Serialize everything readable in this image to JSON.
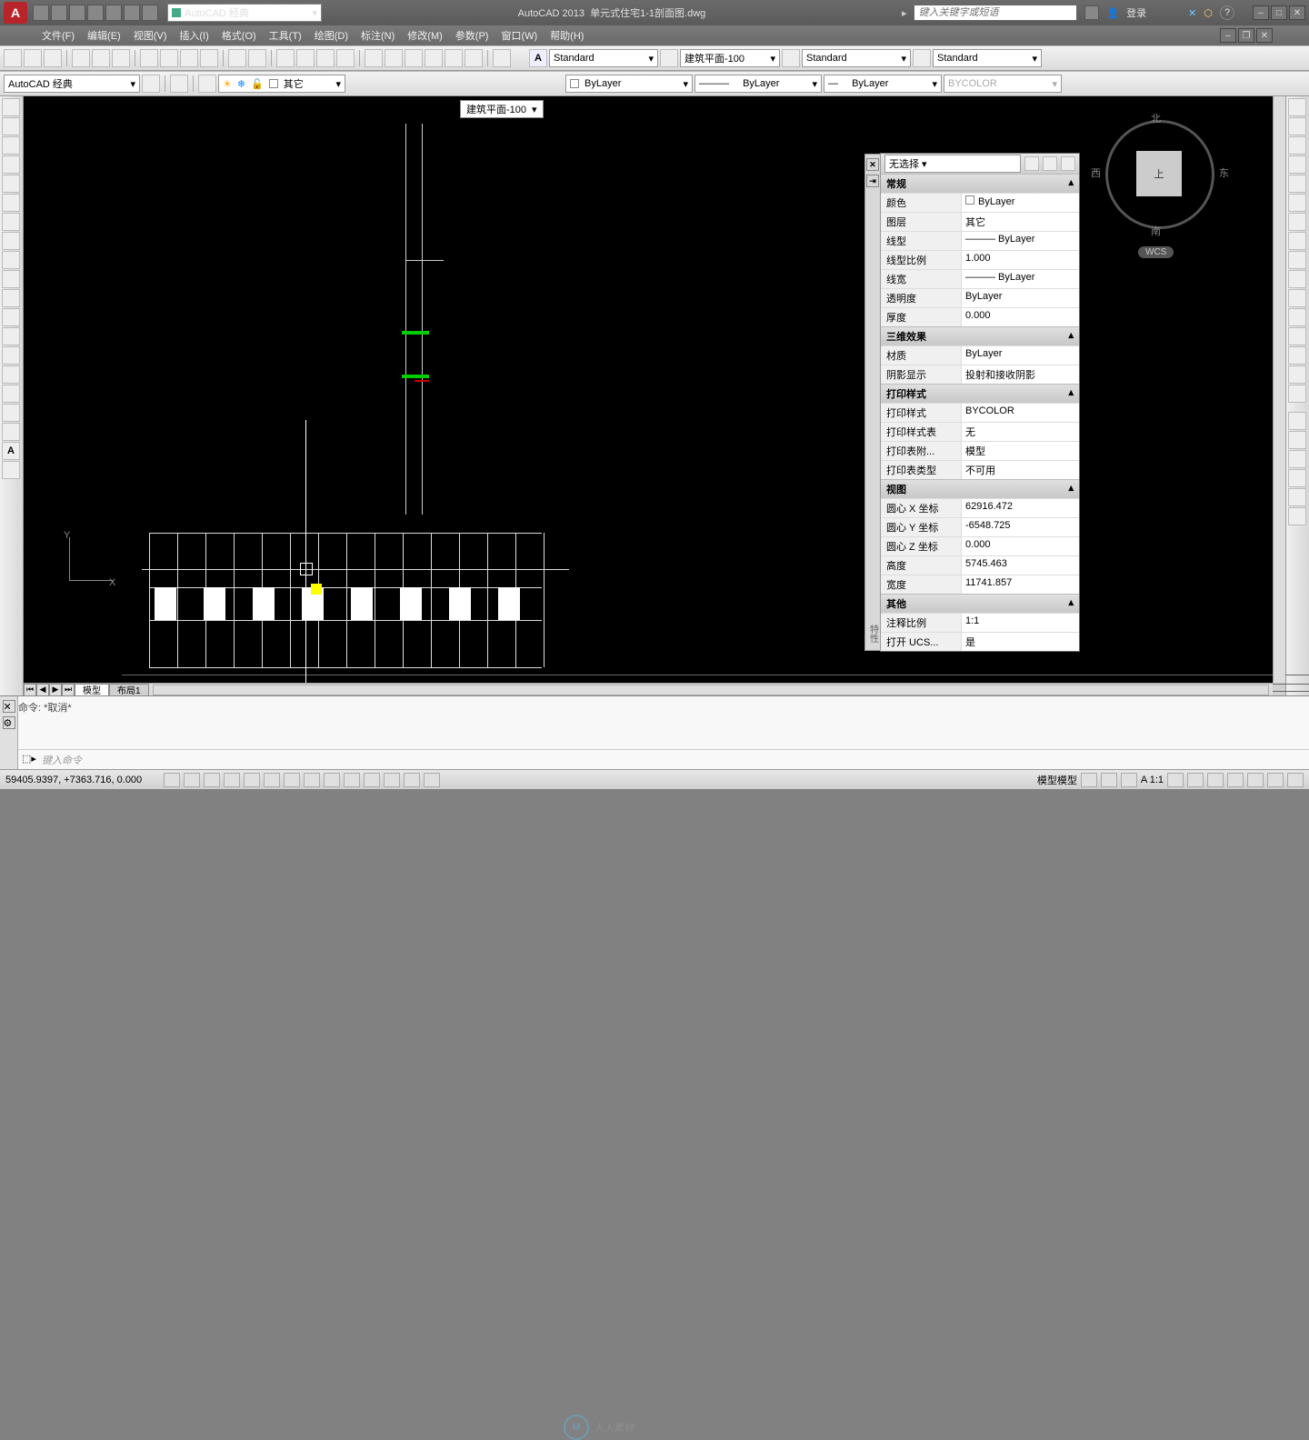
{
  "title": {
    "app": "AutoCAD 2013",
    "file": "单元式住宅1-1剖面图.dwg",
    "search_ph": "键入关键字或短语",
    "login": "登录",
    "workspace": "AutoCAD 经典"
  },
  "menus": [
    "文件(F)",
    "编辑(E)",
    "视图(V)",
    "插入(I)",
    "格式(O)",
    "工具(T)",
    "绘图(D)",
    "标注(N)",
    "修改(M)",
    "参数(P)",
    "窗口(W)",
    "帮助(H)"
  ],
  "tb_styles": {
    "text": "Standard",
    "dim": "建筑平面-100",
    "table": "Standard",
    "mleader": "Standard"
  },
  "tb_layers": {
    "ws": "AutoCAD 经典",
    "layer": "其它",
    "color": "ByLayer",
    "ltype": "ByLayer",
    "lweight": "ByLayer",
    "plotstyle": "BYCOLOR"
  },
  "view_dd": "建筑平面-100",
  "viewcube": {
    "n": "北",
    "s": "南",
    "e": "东",
    "w": "西",
    "top": "上",
    "wcs": "WCS"
  },
  "props": {
    "selector": "无选择",
    "cats": {
      "general": "常规",
      "threed": "三维效果",
      "plot": "打印样式",
      "view": "视图",
      "misc": "其他"
    },
    "general": [
      [
        "颜色",
        "ByLayer"
      ],
      [
        "图层",
        "其它"
      ],
      [
        "线型",
        "ByLayer"
      ],
      [
        "线型比例",
        "1.000"
      ],
      [
        "线宽",
        "ByLayer"
      ],
      [
        "透明度",
        "ByLayer"
      ],
      [
        "厚度",
        "0.000"
      ]
    ],
    "threed": [
      [
        "材质",
        "ByLayer"
      ],
      [
        "阴影显示",
        "投射和接收阴影"
      ]
    ],
    "plot": [
      [
        "打印样式",
        "BYCOLOR"
      ],
      [
        "打印样式表",
        "无"
      ],
      [
        "打印表附...",
        "模型"
      ],
      [
        "打印表类型",
        "不可用"
      ]
    ],
    "view": [
      [
        "圆心 X 坐标",
        "62916.472"
      ],
      [
        "圆心 Y 坐标",
        "-6548.725"
      ],
      [
        "圆心 Z 坐标",
        "0.000"
      ],
      [
        "高度",
        "5745.463"
      ],
      [
        "宽度",
        "11741.857"
      ]
    ],
    "misc": [
      [
        "注释比例",
        "1:1"
      ],
      [
        "打开 UCS...",
        "是"
      ]
    ]
  },
  "tabs": {
    "model": "模型",
    "layout1": "布局1"
  },
  "cmd": {
    "hist": "命令:  *取消*",
    "ph": "键入命令"
  },
  "status": {
    "coords": "59405.9397, +7363.716, 0.000",
    "right": "模型模型",
    "scale": "A 1:1"
  },
  "watermark": "人人素材",
  "ucs": {
    "x": "X",
    "y": "Y"
  }
}
